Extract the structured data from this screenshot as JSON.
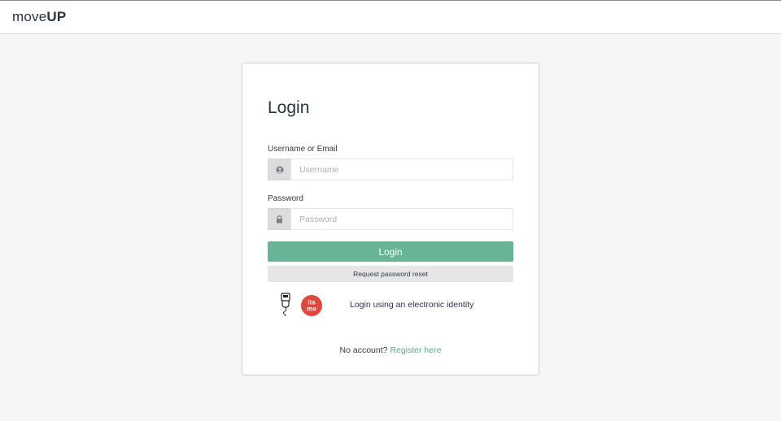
{
  "header": {
    "brand_regular": "move",
    "brand_bold": "UP"
  },
  "login_card": {
    "title": "Login",
    "username": {
      "label": "Username or Email",
      "placeholder": "Username",
      "value": "",
      "icon": "user-circle-icon"
    },
    "password": {
      "label": "Password",
      "placeholder": "Password",
      "value": "",
      "icon": "lock-icon"
    },
    "login_button": "Login",
    "reset_button": "Request password reset",
    "eid": {
      "label": "Login using an electronic identity",
      "icons": [
        "card-reader-icon",
        "itsme-icon"
      ]
    },
    "register": {
      "prompt": "No account?",
      "link": "Register here"
    }
  },
  "colors": {
    "accent_green": "#67b496",
    "link_green": "#5aa98a",
    "itsme_red": "#e0483e",
    "page_background": "#f6f6f6",
    "text_dark": "#2a3440"
  }
}
